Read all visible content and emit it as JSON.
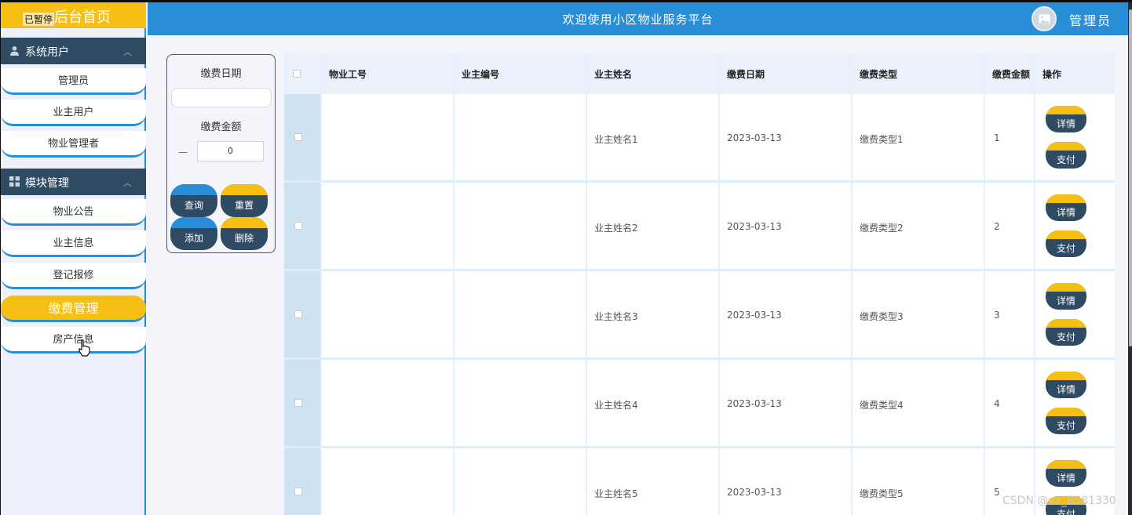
{
  "sidebar": {
    "logo_title": "后台首页",
    "logo_badge": "已暂停",
    "groups": [
      {
        "label": "系统用户",
        "icon": "user-icon",
        "items": [
          "管理员",
          "业主用户",
          "物业管理者"
        ]
      },
      {
        "label": "模块管理",
        "icon": "grid-icon",
        "items": [
          "物业公告",
          "业主信息",
          "登记报修",
          "缴费管理",
          "房产信息"
        ]
      }
    ],
    "active_item": "缴费管理"
  },
  "header": {
    "title": "欢迎使用小区物业服务平台",
    "user": "管理员",
    "avatar_icon": "image-icon"
  },
  "search": {
    "date_label": "缴费日期",
    "amount_label": "缴费金额",
    "amount_value": "0",
    "minus": "—",
    "buttons": {
      "query": "查询",
      "reset": "重置",
      "add": "添加",
      "delete": "删除"
    }
  },
  "table": {
    "columns": [
      "物业工号",
      "业主编号",
      "业主姓名",
      "缴费日期",
      "缴费类型",
      "缴费金额",
      "操作"
    ],
    "rows": [
      {
        "staff_no": "",
        "owner_no": "",
        "owner_name": "业主姓名1",
        "date": "2023-03-13",
        "type": "缴费类型1",
        "amount": "1"
      },
      {
        "staff_no": "",
        "owner_no": "",
        "owner_name": "业主姓名2",
        "date": "2023-03-13",
        "type": "缴费类型2",
        "amount": "2"
      },
      {
        "staff_no": "",
        "owner_no": "",
        "owner_name": "业主姓名3",
        "date": "2023-03-13",
        "type": "缴费类型3",
        "amount": "3"
      },
      {
        "staff_no": "",
        "owner_no": "",
        "owner_name": "业主姓名4",
        "date": "2023-03-13",
        "type": "缴费类型4",
        "amount": "4"
      },
      {
        "staff_no": "",
        "owner_no": "",
        "owner_name": "业主姓名5",
        "date": "2023-03-13",
        "type": "缴费类型5",
        "amount": "5"
      }
    ],
    "actions": {
      "detail": "详情",
      "pay": "支付"
    }
  },
  "watermark": "CSDN @vx_BS81330",
  "colors": {
    "accent_blue": "#2a8ed6",
    "accent_yellow": "#f5bf14",
    "dark_navy": "#2f4b64"
  }
}
